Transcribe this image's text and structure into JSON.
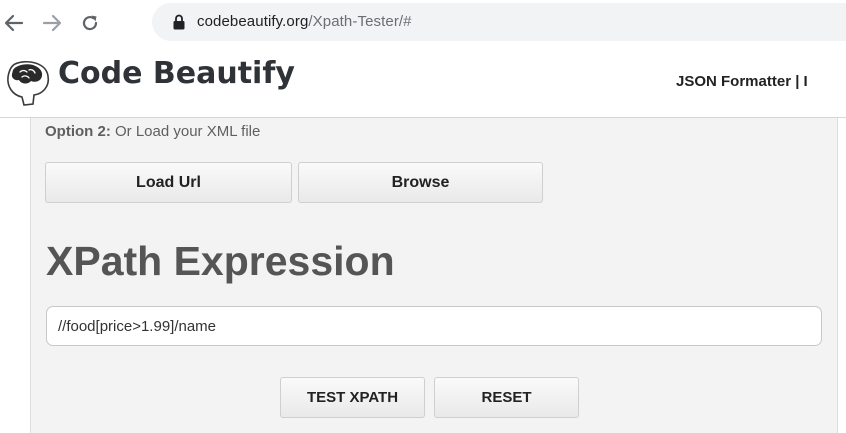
{
  "browser": {
    "url_domain": "codebeautify.org",
    "url_path": "/Xpath-Tester/#",
    "icons": [
      "back-arrow-icon",
      "forward-arrow-icon",
      "reload-icon",
      "lock-icon"
    ]
  },
  "header": {
    "logo_text": "Code Beautify",
    "nav_text": "JSON Formatter | I",
    "icons": [
      "brain-logo-icon"
    ]
  },
  "main": {
    "option_label_bold": "Option 2:",
    "option_label_text": " Or Load your XML file",
    "load_url_label": "Load Url",
    "browse_label": "Browse",
    "section_title": "XPath Expression",
    "xpath_value": "//food[price>1.99]/name",
    "test_button_label": "TEST XPATH",
    "reset_button_label": "RESET"
  },
  "colors": {
    "panel_bg": "#f3f3f3",
    "title_gray": "#555555",
    "omnibox_bg": "#f1f3f4"
  }
}
